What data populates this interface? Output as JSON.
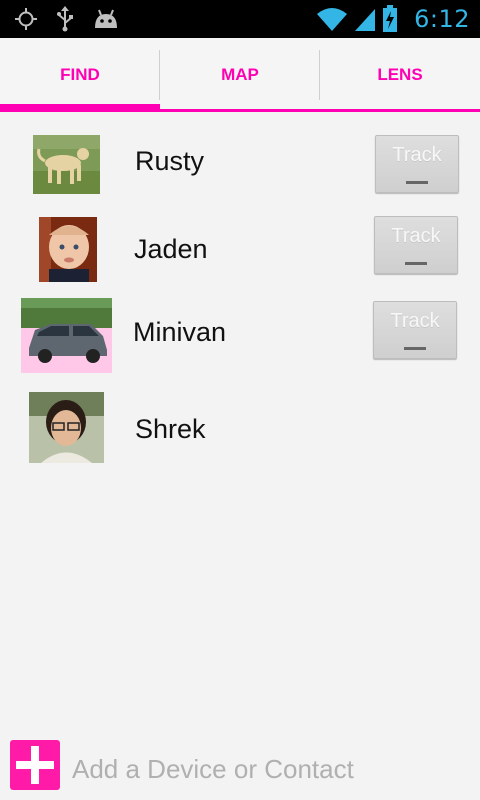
{
  "status_bar": {
    "time": "6:12",
    "icons": [
      "gps-icon",
      "usb-icon",
      "android-icon",
      "wifi-icon",
      "signal-icon",
      "battery-charging-icon"
    ],
    "accent": "#33b5e5"
  },
  "tabs": [
    {
      "label": "FIND",
      "selected": true
    },
    {
      "label": "MAP",
      "selected": false
    },
    {
      "label": "LENS",
      "selected": false
    }
  ],
  "accent_color": "#ff00b4",
  "items": [
    {
      "name": "Rusty",
      "thumbnail": "dog-photo",
      "button": "Track"
    },
    {
      "name": "Jaden",
      "thumbnail": "baby-photo",
      "button": "Track"
    },
    {
      "name": "Minivan",
      "thumbnail": "minivan-photo",
      "button": "Track"
    },
    {
      "name": "Shrek",
      "thumbnail": "person-photo",
      "button": null
    }
  ],
  "add_bar": {
    "placeholder": "Add a Device or Contact"
  }
}
